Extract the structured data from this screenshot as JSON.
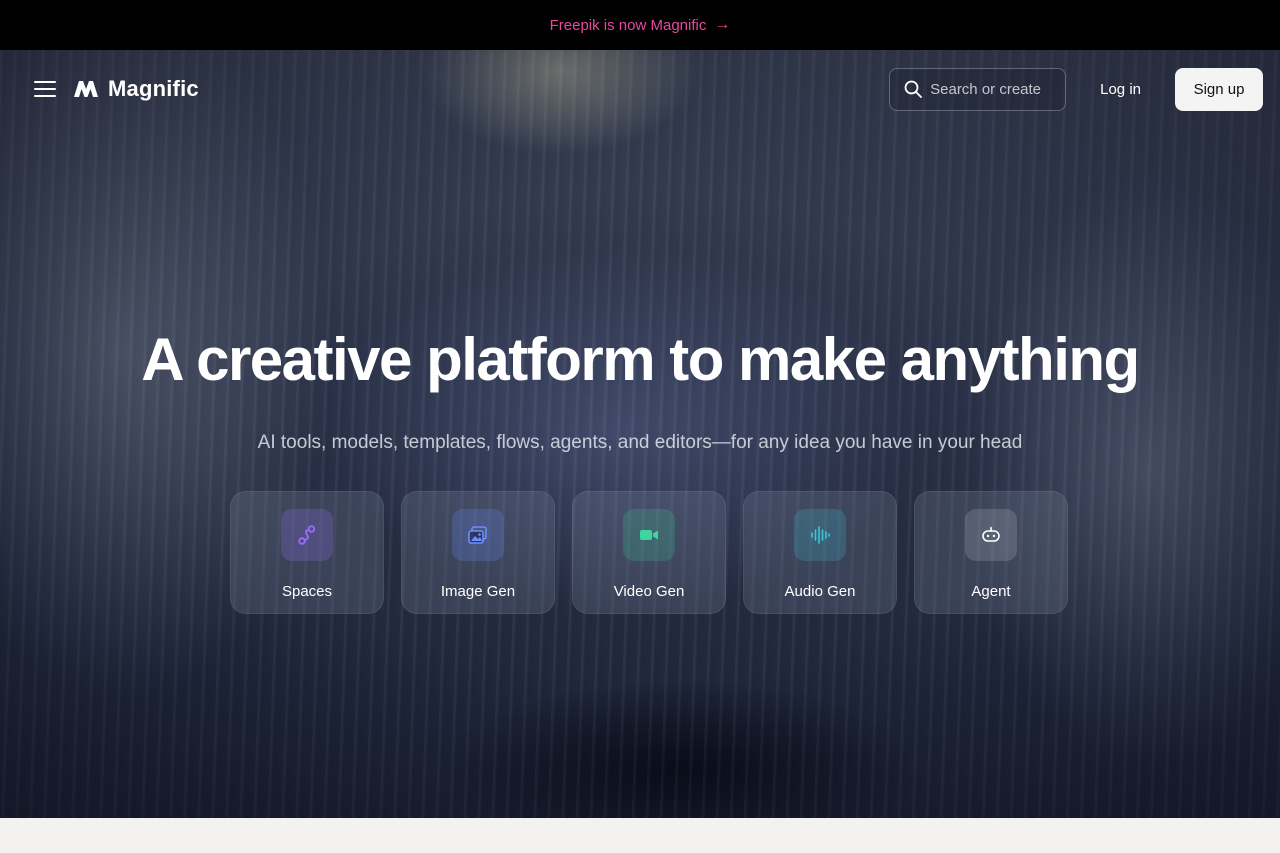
{
  "announcement": {
    "text": "Freepik is now Magnific",
    "arrow": "→",
    "color": "#e8489b"
  },
  "nav": {
    "brand": "Magnific",
    "search_placeholder": "Search or create",
    "login_label": "Log in",
    "signup_label": "Sign up"
  },
  "hero": {
    "headline": "A creative platform to make anything",
    "subhead": "AI tools, models, templates, flows, agents, and editors—for any idea you have in your head"
  },
  "tools": [
    {
      "label": "Spaces",
      "icon": "spaces-icon",
      "color": "#9b6bff"
    },
    {
      "label": "Image Gen",
      "icon": "image-gen-icon",
      "color": "#6f8dff"
    },
    {
      "label": "Video Gen",
      "icon": "video-gen-icon",
      "color": "#3ed6a0"
    },
    {
      "label": "Audio Gen",
      "icon": "audio-gen-icon",
      "color": "#3fc6d9"
    },
    {
      "label": "Agent",
      "icon": "agent-icon",
      "color": "#ffffff"
    }
  ]
}
